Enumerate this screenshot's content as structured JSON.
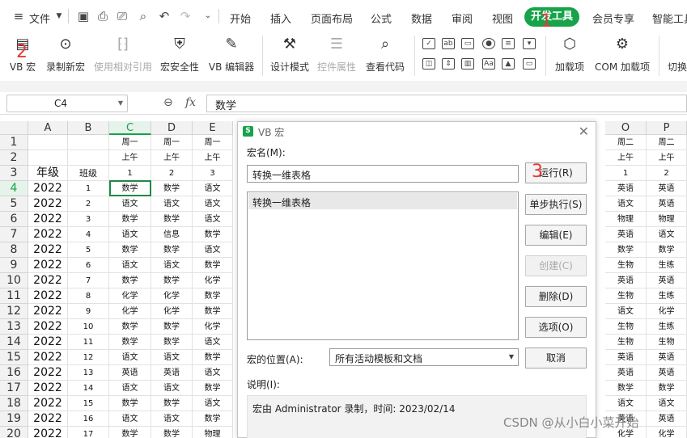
{
  "menubar": {
    "file": "文件",
    "tabs": [
      "开始",
      "插入",
      "页面布局",
      "公式",
      "数据",
      "审阅",
      "视图",
      "开发工具",
      "会员专享",
      "智能工具"
    ],
    "active_tab": "开发工具"
  },
  "ribbon": {
    "vb_macro": "VB 宏",
    "record_macro": "录制新宏",
    "relative_ref": "使用相对引用",
    "macro_security": "宏安全性",
    "vb_editor": "VB 编辑器",
    "design_mode": "设计模式",
    "control_props": "控件属性",
    "view_code": "查看代码",
    "addins": "加载项",
    "com_addins": "COM 加载项",
    "switch": "切换"
  },
  "formula_bar": {
    "cell_ref": "C4",
    "fx": "fx",
    "value": "数学"
  },
  "sheet": {
    "columns": [
      "A",
      "B",
      "C",
      "D",
      "E"
    ],
    "right_columns": [
      "O",
      "P"
    ],
    "selected_column": "C",
    "rows": [
      {
        "n": "1",
        "a": "",
        "b": "",
        "c": "周一",
        "d": "周一",
        "e": "周一",
        "o": "周二",
        "p": "周二"
      },
      {
        "n": "2",
        "a": "",
        "b": "",
        "c": "上午",
        "d": "上午",
        "e": "上午",
        "o": "上午",
        "p": "上午"
      },
      {
        "n": "3",
        "a": "年级",
        "b": "班级",
        "c": "1",
        "d": "2",
        "e": "3",
        "o": "1",
        "p": "2"
      },
      {
        "n": "4",
        "a": "2022",
        "b": "1",
        "c": "数学",
        "d": "数学",
        "e": "语文",
        "o": "英语",
        "p": "英语"
      },
      {
        "n": "5",
        "a": "2022",
        "b": "2",
        "c": "语文",
        "d": "语文",
        "e": "语文",
        "o": "语文",
        "p": "英语"
      },
      {
        "n": "6",
        "a": "2022",
        "b": "3",
        "c": "数学",
        "d": "数学",
        "e": "语文",
        "o": "物理",
        "p": "物理"
      },
      {
        "n": "7",
        "a": "2022",
        "b": "4",
        "c": "语文",
        "d": "信息",
        "e": "数学",
        "o": "英语",
        "p": "语文"
      },
      {
        "n": "8",
        "a": "2022",
        "b": "5",
        "c": "数学",
        "d": "数学",
        "e": "语文",
        "o": "数学",
        "p": "数学"
      },
      {
        "n": "9",
        "a": "2022",
        "b": "6",
        "c": "语文",
        "d": "语文",
        "e": "数学",
        "o": "生物",
        "p": "生练"
      },
      {
        "n": "10",
        "a": "2022",
        "b": "7",
        "c": "数学",
        "d": "数学",
        "e": "化学",
        "o": "英语",
        "p": "英语"
      },
      {
        "n": "11",
        "a": "2022",
        "b": "8",
        "c": "化学",
        "d": "化学",
        "e": "数学",
        "o": "生物",
        "p": "生练"
      },
      {
        "n": "12",
        "a": "2022",
        "b": "9",
        "c": "化学",
        "d": "化学",
        "e": "数学",
        "o": "语文",
        "p": "化学"
      },
      {
        "n": "13",
        "a": "2022",
        "b": "10",
        "c": "数学",
        "d": "数学",
        "e": "化学",
        "o": "生物",
        "p": "生练"
      },
      {
        "n": "14",
        "a": "2022",
        "b": "11",
        "c": "数学",
        "d": "数学",
        "e": "语文",
        "o": "生物",
        "p": "生物"
      },
      {
        "n": "15",
        "a": "2022",
        "b": "12",
        "c": "语文",
        "d": "语文",
        "e": "数学",
        "o": "英语",
        "p": "英语"
      },
      {
        "n": "16",
        "a": "2022",
        "b": "13",
        "c": "英语",
        "d": "英语",
        "e": "语文",
        "o": "英语",
        "p": "英语"
      },
      {
        "n": "17",
        "a": "2022",
        "b": "14",
        "c": "语文",
        "d": "语文",
        "e": "数学",
        "o": "数学",
        "p": "数学"
      },
      {
        "n": "18",
        "a": "2022",
        "b": "15",
        "c": "数学",
        "d": "数学",
        "e": "语文",
        "o": "语文",
        "p": "语文"
      },
      {
        "n": "19",
        "a": "2022",
        "b": "16",
        "c": "语文",
        "d": "语文",
        "e": "数学",
        "o": "英语",
        "p": "英语"
      },
      {
        "n": "20",
        "a": "2022",
        "b": "17",
        "c": "数学",
        "d": "数学",
        "e": "物理",
        "o": "化学",
        "p": "化学"
      }
    ]
  },
  "dialog": {
    "title": "VB 宏",
    "name_label": "宏名(M):",
    "name_value": "转换一维表格",
    "list_items": [
      "转换一维表格"
    ],
    "buttons": {
      "run": "运行(R)",
      "step": "单步执行(S)",
      "edit": "编辑(E)",
      "create": "创建(C)",
      "delete": "删除(D)",
      "options": "选项(O)",
      "cancel": "取消"
    },
    "location_label": "宏的位置(A):",
    "location_value": "所有活动模板和文档",
    "desc_label": "说明(I):",
    "desc_value": "宏由 Administrator 录制，时间: 2023/02/14"
  },
  "annotations": [
    "1",
    "2",
    "3"
  ],
  "watermark": "CSDN @从小白小菜开始",
  "colors": {
    "accent": "#16a34a",
    "annotation": "#e53935"
  }
}
